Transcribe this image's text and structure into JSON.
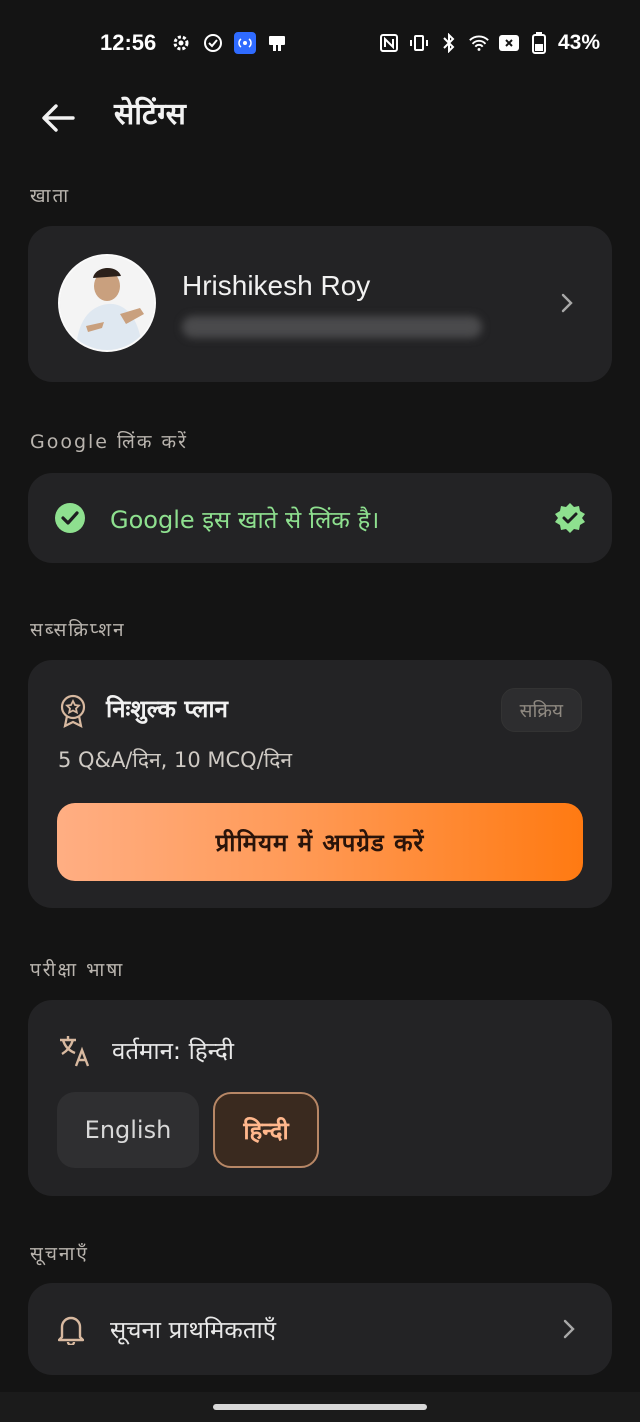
{
  "status_bar": {
    "time": "12:56",
    "battery": "43%",
    "left_icons": [
      "gear-icon",
      "check-circle-icon",
      "hotspot-icon",
      "nfc-pay-icon"
    ],
    "right_icons": [
      "nfc-icon",
      "vibrate-icon",
      "bluetooth-icon",
      "wifi-icon",
      "no-sim-icon",
      "battery-icon"
    ]
  },
  "header": {
    "title": "सेटिंग्स"
  },
  "account": {
    "section_label": "खाता",
    "name": "Hrishikesh Roy"
  },
  "google": {
    "section_label": "Google लिंक करें",
    "status_text": "Google इस खाते से लिंक है।",
    "color": "#8ee08f"
  },
  "subscription": {
    "section_label": "सब्सक्रिप्शन",
    "plan_name": "निःशुल्क प्लान",
    "badge": "सक्रिय",
    "limits": "5 Q&A/दिन, 10 MCQ/दिन",
    "upgrade_label": "प्रीमियम में अपग्रेड करें",
    "accent": "#ff7a12"
  },
  "language": {
    "section_label": "परीक्षा भाषा",
    "current": "वर्तमान: हिन्दी",
    "options": [
      "English",
      "हिन्दी"
    ],
    "selected": "हिन्दी"
  },
  "notifications": {
    "section_label": "सूचनाएँ",
    "item_label": "सूचना प्राथमिकताएँ"
  }
}
